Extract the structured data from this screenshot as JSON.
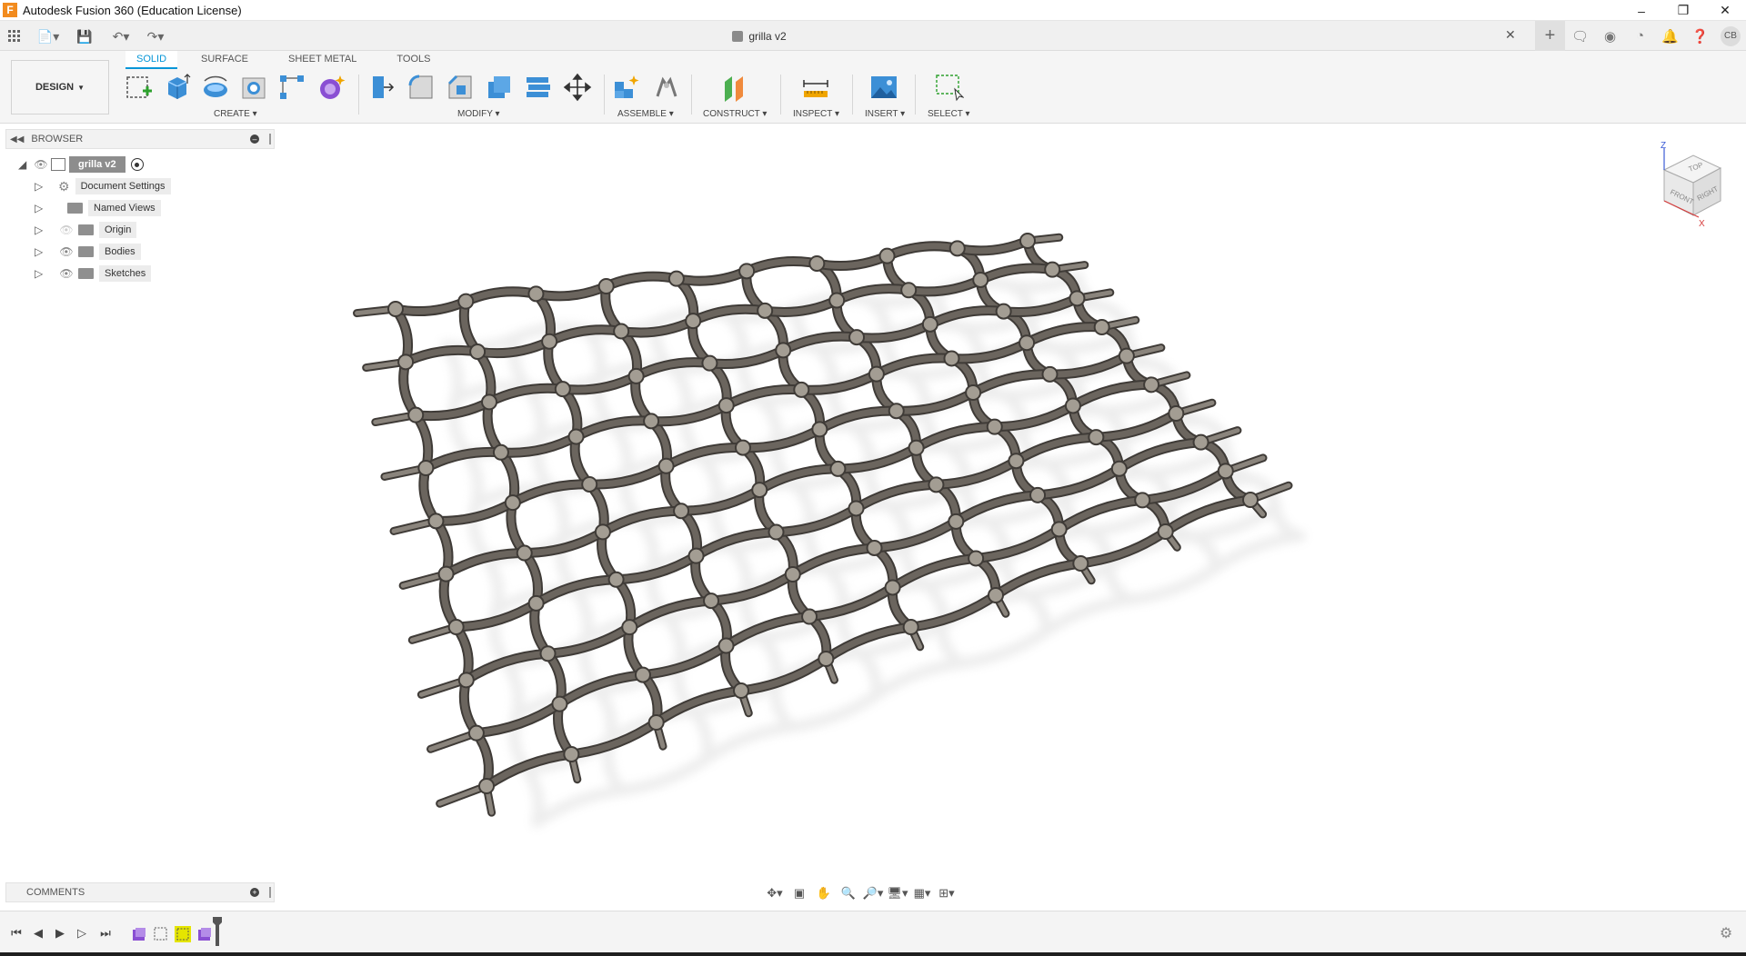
{
  "window": {
    "title": "Autodesk Fusion 360 (Education License)",
    "logo_letter": "F"
  },
  "document": {
    "title": "grilla v2"
  },
  "account": {
    "initials": "CB"
  },
  "ribbon": {
    "workspace": "DESIGN",
    "tabs": [
      "SOLID",
      "SURFACE",
      "SHEET METAL",
      "TOOLS"
    ],
    "active_tab": "SOLID",
    "groups": {
      "create": "CREATE",
      "modify": "MODIFY",
      "assemble": "ASSEMBLE",
      "construct": "CONSTRUCT",
      "inspect": "INSPECT",
      "insert": "INSERT",
      "select": "SELECT"
    }
  },
  "browser": {
    "title": "BROWSER",
    "root": "grilla v2",
    "items": [
      {
        "label": "Document Settings",
        "icon": "gear-icon"
      },
      {
        "label": "Named Views",
        "icon": "folder-icon"
      },
      {
        "label": "Origin",
        "icon": "folder-icon",
        "hidden": true
      },
      {
        "label": "Bodies",
        "icon": "folder-icon"
      },
      {
        "label": "Sketches",
        "icon": "folder-icon"
      }
    ]
  },
  "comments": {
    "title": "COMMENTS"
  },
  "viewcube": {
    "top": "TOP",
    "front": "FRONT",
    "right": "RIGHT",
    "axis_z": "Z",
    "axis_x": "X"
  },
  "colors": {
    "accent": "#0696d7",
    "model": "#6b655e",
    "shadow": "#d8d8d8"
  }
}
